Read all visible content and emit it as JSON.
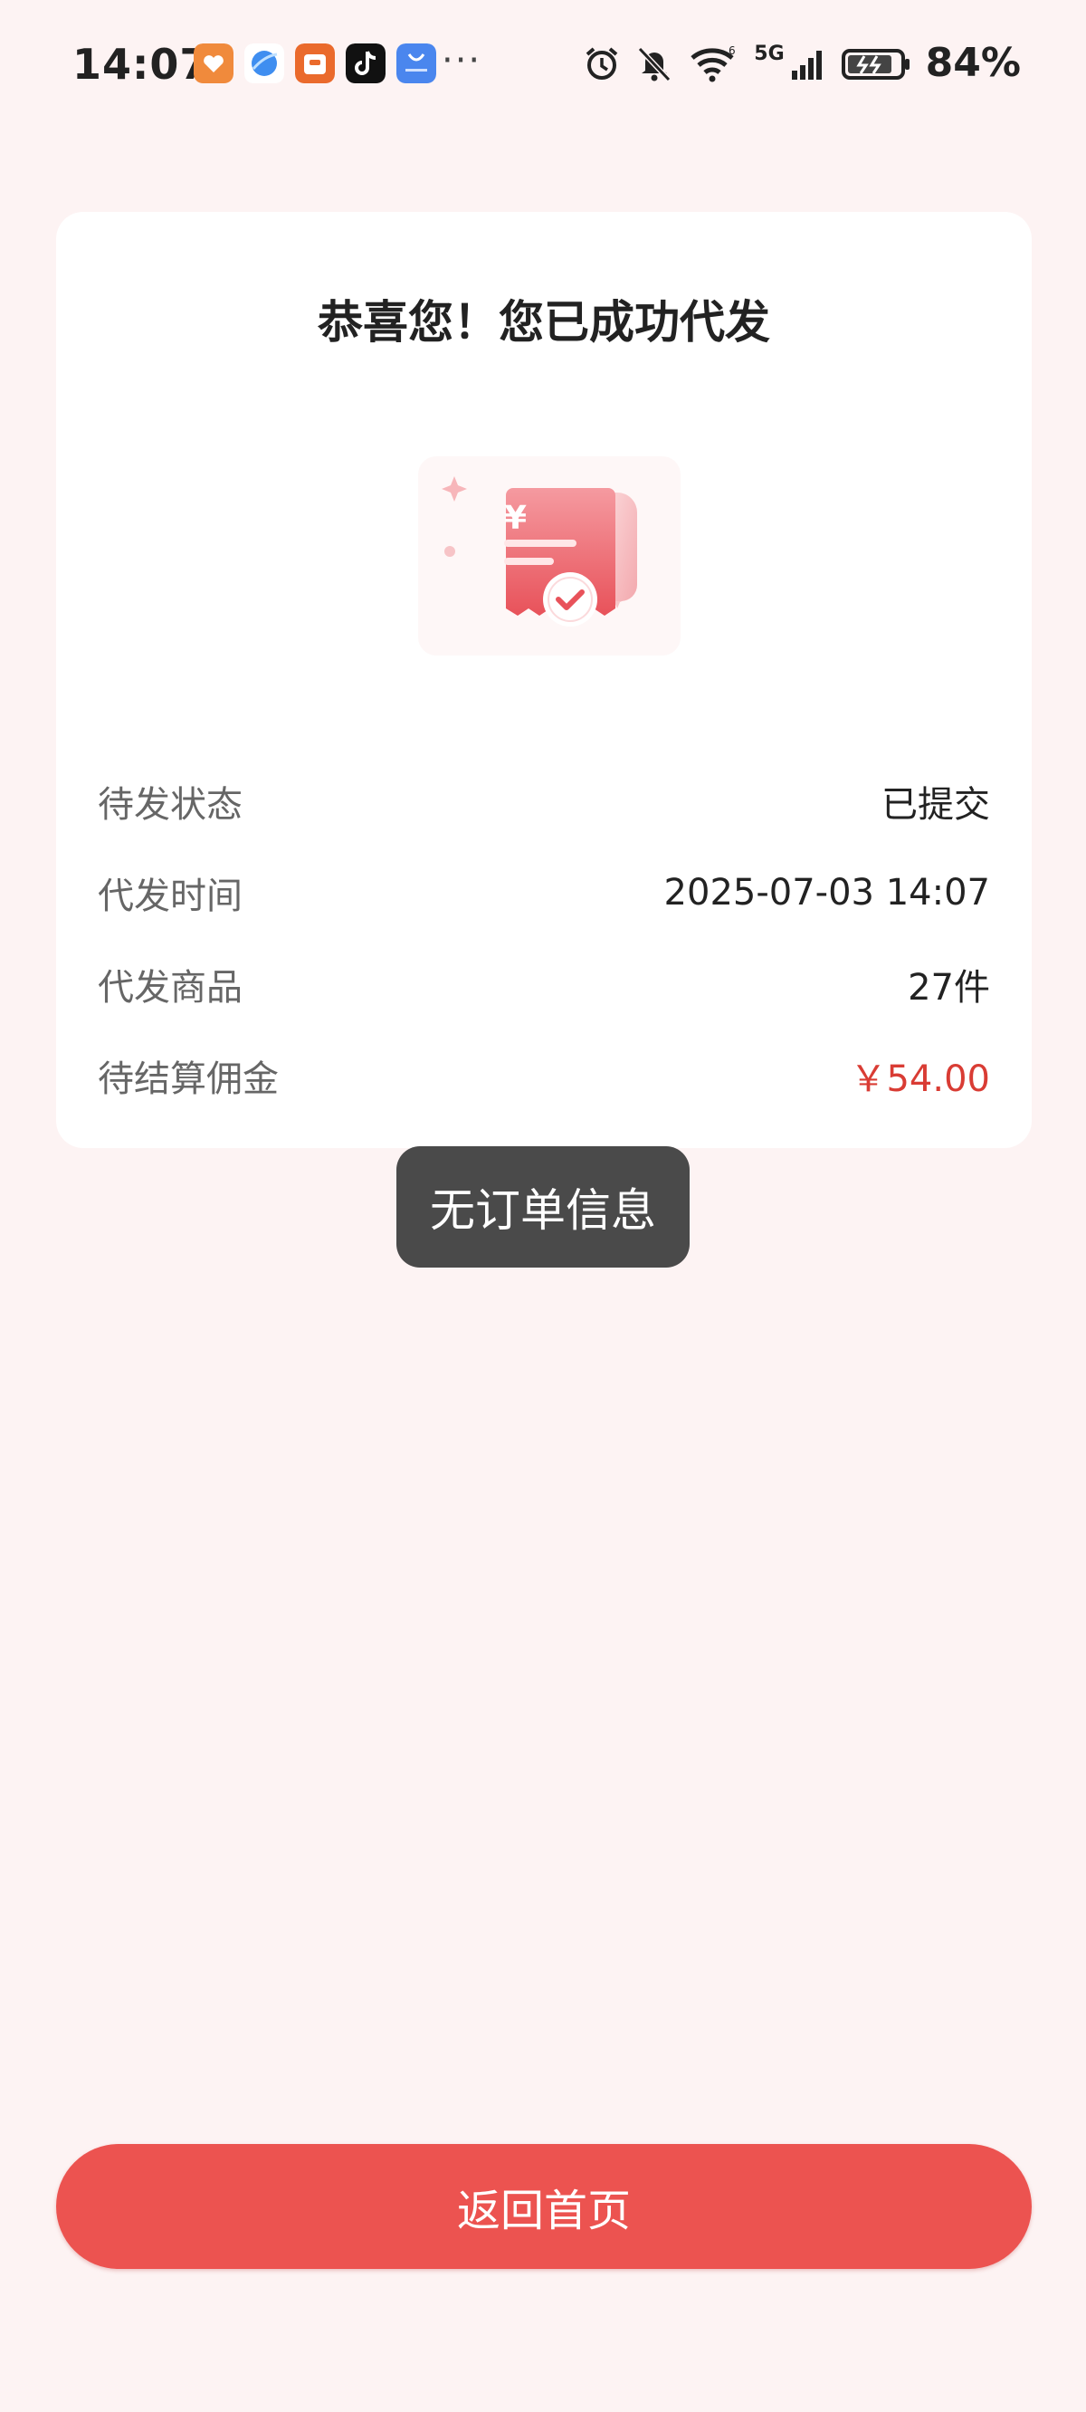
{
  "status_bar": {
    "time": "14:07",
    "battery_percent": "84%",
    "network": "5G",
    "notification_app_icons": [
      "mini-program-heart-icon",
      "browser-icon",
      "shop-app-icon",
      "tiktok-icon",
      "honor-store-icon"
    ],
    "more": "···"
  },
  "result": {
    "title": "恭喜您！您已成功代发",
    "illustration": "receipt-check-icon",
    "rows": [
      {
        "label": "待发状态",
        "value": "已提交"
      },
      {
        "label": "代发时间",
        "value": "2025-07-03 14:07"
      },
      {
        "label": "代发商品",
        "value": "27件"
      },
      {
        "label": "待结算佣金",
        "value": "￥54.00"
      }
    ]
  },
  "toast": {
    "message": "无订单信息"
  },
  "footer": {
    "home_button": "返回首页"
  },
  "colors": {
    "page_background": "#fdf3f3",
    "accent": "#ec5350",
    "commission": "#d93c34",
    "toast_background": "#4a4a4a"
  }
}
